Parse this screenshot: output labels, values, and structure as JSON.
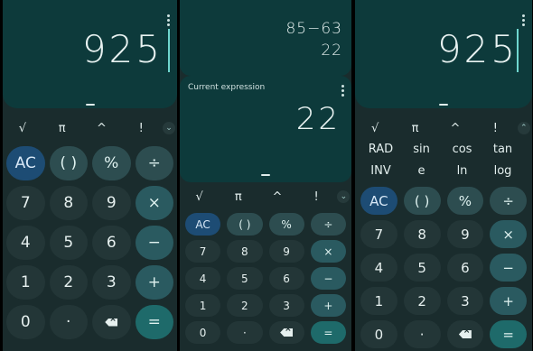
{
  "panel1": {
    "result": "925",
    "scientific": [
      "√",
      "π",
      "^",
      "!"
    ],
    "keys": [
      {
        "label": "AC",
        "type": "ac",
        "name": "ac-button"
      },
      {
        "label": "( )",
        "type": "op",
        "name": "parentheses-button"
      },
      {
        "label": "%",
        "type": "op",
        "name": "percent-button"
      },
      {
        "label": "÷",
        "type": "op",
        "name": "divide-button"
      },
      {
        "label": "7",
        "type": "num",
        "name": "digit-7-button"
      },
      {
        "label": "8",
        "type": "num",
        "name": "digit-8-button"
      },
      {
        "label": "9",
        "type": "num",
        "name": "digit-9-button"
      },
      {
        "label": "×",
        "type": "opstrong",
        "name": "multiply-button"
      },
      {
        "label": "4",
        "type": "num",
        "name": "digit-4-button"
      },
      {
        "label": "5",
        "type": "num",
        "name": "digit-5-button"
      },
      {
        "label": "6",
        "type": "num",
        "name": "digit-6-button"
      },
      {
        "label": "−",
        "type": "opstrong",
        "name": "minus-button"
      },
      {
        "label": "1",
        "type": "num",
        "name": "digit-1-button"
      },
      {
        "label": "2",
        "type": "num",
        "name": "digit-2-button"
      },
      {
        "label": "3",
        "type": "num",
        "name": "digit-3-button"
      },
      {
        "label": "+",
        "type": "opstrong",
        "name": "plus-button"
      },
      {
        "label": "0",
        "type": "num",
        "name": "digit-0-button"
      },
      {
        "label": "·",
        "type": "num",
        "name": "decimal-button"
      },
      {
        "label": "",
        "type": "back",
        "name": "backspace-button"
      },
      {
        "label": "=",
        "type": "eq",
        "name": "equals-button"
      }
    ]
  },
  "panel2": {
    "history_expression": "85−63",
    "history_result": "22",
    "current_label": "Current expression",
    "result": "22",
    "scientific": [
      "√",
      "π",
      "^",
      "!"
    ],
    "keys": [
      {
        "label": "AC",
        "type": "ac",
        "name": "ac-button"
      },
      {
        "label": "( )",
        "type": "op",
        "name": "parentheses-button"
      },
      {
        "label": "%",
        "type": "op",
        "name": "percent-button"
      },
      {
        "label": "÷",
        "type": "op",
        "name": "divide-button"
      },
      {
        "label": "7",
        "type": "num",
        "name": "digit-7-button"
      },
      {
        "label": "8",
        "type": "num",
        "name": "digit-8-button"
      },
      {
        "label": "9",
        "type": "num",
        "name": "digit-9-button"
      },
      {
        "label": "×",
        "type": "opstrong",
        "name": "multiply-button"
      },
      {
        "label": "4",
        "type": "num",
        "name": "digit-4-button"
      },
      {
        "label": "5",
        "type": "num",
        "name": "digit-5-button"
      },
      {
        "label": "6",
        "type": "num",
        "name": "digit-6-button"
      },
      {
        "label": "−",
        "type": "opstrong",
        "name": "minus-button"
      },
      {
        "label": "1",
        "type": "num",
        "name": "digit-1-button"
      },
      {
        "label": "2",
        "type": "num",
        "name": "digit-2-button"
      },
      {
        "label": "3",
        "type": "num",
        "name": "digit-3-button"
      },
      {
        "label": "+",
        "type": "opstrong",
        "name": "plus-button"
      },
      {
        "label": "0",
        "type": "num",
        "name": "digit-0-button"
      },
      {
        "label": "·",
        "type": "num",
        "name": "decimal-button"
      },
      {
        "label": "",
        "type": "back",
        "name": "backspace-button"
      },
      {
        "label": "=",
        "type": "eq",
        "name": "equals-button"
      }
    ]
  },
  "panel3": {
    "result": "925",
    "scientific": [
      "√",
      "π",
      "^",
      "!"
    ],
    "scientific_row2": [
      "RAD",
      "sin",
      "cos",
      "tan"
    ],
    "scientific_row3": [
      "INV",
      "e",
      "ln",
      "log"
    ],
    "keys": [
      {
        "label": "AC",
        "type": "ac",
        "name": "ac-button"
      },
      {
        "label": "( )",
        "type": "op",
        "name": "parentheses-button"
      },
      {
        "label": "%",
        "type": "op",
        "name": "percent-button"
      },
      {
        "label": "÷",
        "type": "op",
        "name": "divide-button"
      },
      {
        "label": "7",
        "type": "num",
        "name": "digit-7-button"
      },
      {
        "label": "8",
        "type": "num",
        "name": "digit-8-button"
      },
      {
        "label": "9",
        "type": "num",
        "name": "digit-9-button"
      },
      {
        "label": "×",
        "type": "opstrong",
        "name": "multiply-button"
      },
      {
        "label": "4",
        "type": "num",
        "name": "digit-4-button"
      },
      {
        "label": "5",
        "type": "num",
        "name": "digit-5-button"
      },
      {
        "label": "6",
        "type": "num",
        "name": "digit-6-button"
      },
      {
        "label": "−",
        "type": "opstrong",
        "name": "minus-button"
      },
      {
        "label": "1",
        "type": "num",
        "name": "digit-1-button"
      },
      {
        "label": "2",
        "type": "num",
        "name": "digit-2-button"
      },
      {
        "label": "3",
        "type": "num",
        "name": "digit-3-button"
      },
      {
        "label": "+",
        "type": "opstrong",
        "name": "plus-button"
      },
      {
        "label": "0",
        "type": "num",
        "name": "digit-0-button"
      },
      {
        "label": "·",
        "type": "num",
        "name": "decimal-button"
      },
      {
        "label": "",
        "type": "back",
        "name": "backspace-button"
      },
      {
        "label": "=",
        "type": "eq",
        "name": "equals-button"
      }
    ]
  },
  "colors": {
    "display_bg": "#0d3a3b",
    "panel_bg": "#1a2c2d",
    "digit_key": "#233637",
    "operator_key": "#2d4d50",
    "ac_key": "#1d4c74",
    "equals_key": "#1e6a6a",
    "cursor": "#6fd6cf"
  },
  "icons": {
    "backspace": "backspace-icon",
    "overflow_menu": "more-vert-icon",
    "expand": "chevron-down-icon"
  }
}
